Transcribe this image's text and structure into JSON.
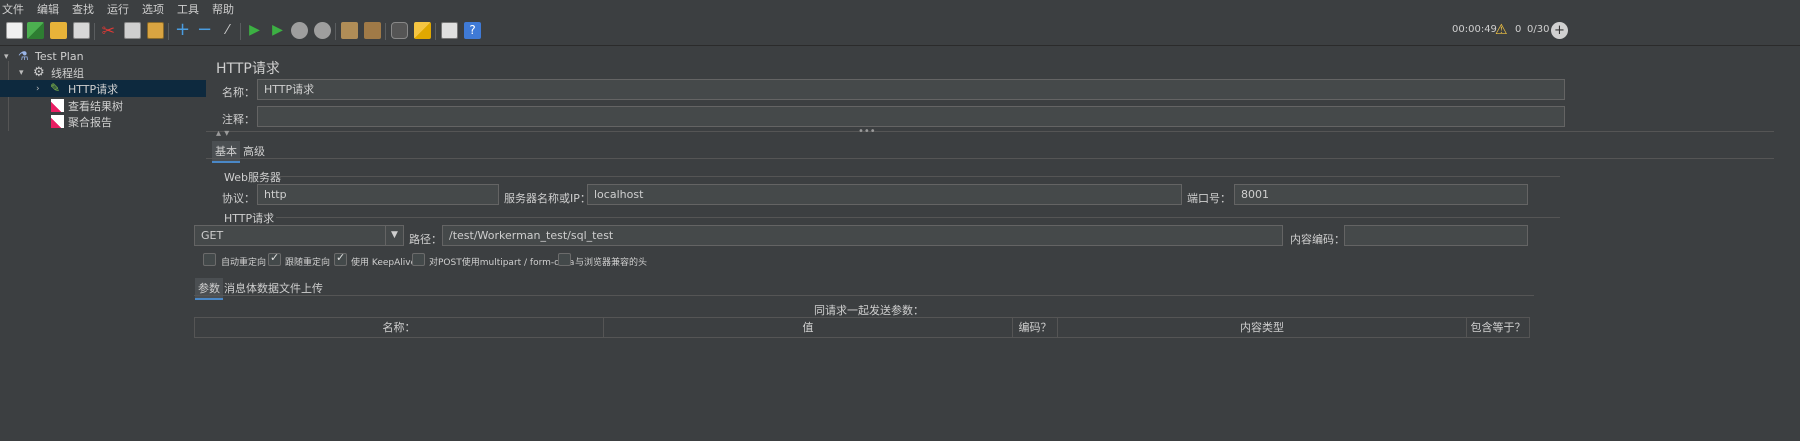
{
  "menu": [
    "文件",
    "编辑",
    "查找",
    "运行",
    "选项",
    "工具",
    "帮助"
  ],
  "status": {
    "timer": "00:00:49",
    "warnings": "0",
    "threads": "0/30"
  },
  "colors": {
    "selected_row": "#0d293e",
    "accent_tab": "#4a88c7",
    "background": "#3c3f41"
  },
  "tree": {
    "root": "Test Plan",
    "thread_group": "线程组",
    "items": [
      "HTTP请求",
      "查看结果树",
      "聚合报告"
    ]
  },
  "main": {
    "title": "HTTP请求",
    "name_label": "名称：",
    "name_value": "HTTP请求",
    "comment_label": "注释：",
    "comment_value": "",
    "tabs": [
      "基本",
      "高级"
    ],
    "web_server": {
      "title": "Web服务器",
      "protocol_label": "协议：",
      "protocol_value": "http",
      "server_label": "服务器名称或IP：",
      "server_value": "localhost",
      "port_label": "端口号：",
      "port_value": "8001"
    },
    "http_request": {
      "title": "HTTP请求",
      "method": "GET",
      "path_label": "路径：",
      "path_value": "/test/Workerman_test/sql_test",
      "encoding_label": "内容编码：",
      "encoding_value": ""
    },
    "options": [
      {
        "label": "自动重定向",
        "checked": false
      },
      {
        "label": "跟随重定向",
        "checked": true
      },
      {
        "label": "使用 KeepAlive",
        "checked": true
      },
      {
        "label": "对POST使用multipart / form-data",
        "checked": false
      },
      {
        "label": "与浏览器兼容的头",
        "checked": false
      }
    ],
    "sub_tabs": [
      "参数",
      "消息体数据",
      "文件上传"
    ],
    "table": {
      "caption": "同请求一起发送参数：",
      "columns": [
        "名称：",
        "值",
        "编码？",
        "内容类型",
        "包含等于？"
      ]
    }
  }
}
